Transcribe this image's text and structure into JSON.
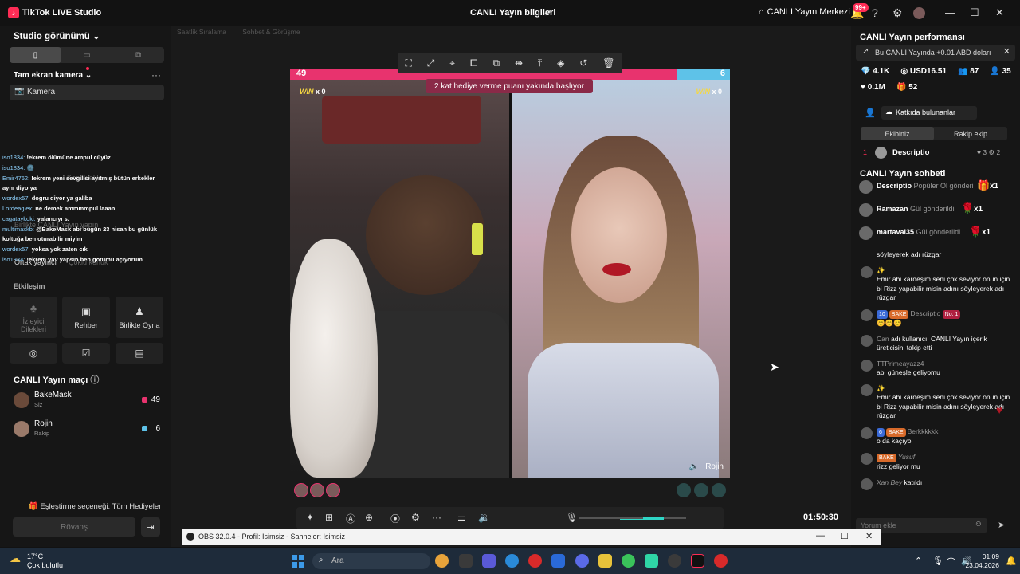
{
  "titlebar": {
    "app_name": "TikTok LIVE Studio",
    "center_title": "CANLI Yayın bilgileri",
    "live_center": "CANLI Yayın Merkezi",
    "notif_badge": "99+"
  },
  "left": {
    "studio_view": "Studio görünümü",
    "fullscreen_camera": "Tam ekran kamera",
    "camera": "Kamera",
    "chat_overlay": [
      {
        "user": "iso1834:",
        "text": "!ekrem ölümüne ampul cüyüz"
      },
      {
        "user": "iso1834:",
        "text": "🌚"
      },
      {
        "user": "Emir4762:",
        "text": "!ekrem yeni sevgilisi ayıtmış bütün erkekler aynı diyo ya"
      },
      {
        "user": "wordex57:",
        "text": "dogru diyor ya galiba"
      },
      {
        "user": "Lordeaglex:",
        "text": "ne demek ammmmpul laaan"
      },
      {
        "user": "cagataykoki:",
        "text": "yalancıyı s."
      },
      {
        "user": "multimaxkb:",
        "text": "@BakeMask abi bugün 23 nisan bu günlük koltuğa ben oturabilir miyim"
      },
      {
        "user": "wordex57:",
        "text": "yoksa yok zaten cık"
      },
      {
        "user": "iso1834:",
        "text": "!ekrem yav yapsın ben götümü açıyorum"
      }
    ],
    "ghost_labels": [
      "Konuk ekle",
      "Birlikte CANLI Yayın yapın",
      "Ortak yayıncı",
      "Çoklu konuk"
    ],
    "engagement_title": "Etkileşim",
    "tiles": [
      {
        "icon": "♣",
        "label": "İzleyici Dilekleri"
      },
      {
        "icon": "▣",
        "label": "Rehber"
      },
      {
        "icon": "♟",
        "label": "Birlikte Oyna"
      }
    ],
    "match_title": "CANLI Yayın maçı",
    "players": [
      {
        "name": "BakeMask",
        "sub": "Siz",
        "score": "49"
      },
      {
        "name": "Rojin",
        "sub": "Rakip",
        "score": "6"
      }
    ],
    "pairing": "Eşleştirme seçeneği: Tüm Hediyeler",
    "rematch": "Rövanş"
  },
  "center": {
    "chips": [
      "Saatlik Sıralama",
      "Sohbet & Görüşme"
    ],
    "score_left": "49",
    "score_right": "6",
    "win_left": "WIN",
    "win_left_count": "x 0",
    "win_right": "WIN",
    "win_right_count": "x 0",
    "banner": "2 kat hediye verme puanı yakında başlıyor",
    "opponent_name": "Rojin",
    "timer": "01:50:30",
    "volume_level": 0.66
  },
  "right": {
    "perf_title": "CANLI Yayın performansı",
    "perf_note": "Bu CANLI Yayında +0.01 ABD doları",
    "stats_row1": [
      "4.1K",
      "USD16.51",
      "87",
      "35"
    ],
    "stats_row2": [
      "0.1M",
      "52"
    ],
    "contributors": "Katkıda bulunanlar",
    "tab_team": "Ekibiniz",
    "tab_rival": "Rakip ekip",
    "rank_num": "1",
    "rank_name": "Descriptio",
    "rank_stats": "♥ 3  ⚙ 2",
    "chat_title": "CANLI Yayın sohbeti",
    "gifts": [
      {
        "name": "Descriptio",
        "action": "Popüler Ol gönderi",
        "count": "x1"
      },
      {
        "name": "Ramazan",
        "action": "Gül gönderildi",
        "count": "x1"
      },
      {
        "name": "martaval35",
        "action": "Gül gönderildi",
        "count": "x1"
      }
    ],
    "messages": [
      {
        "name": "",
        "text": "söyleyerek adı rüzgar"
      },
      {
        "name": "✨",
        "text": "Emir abi kardeşim seni çok seviyor onun için bi Rizz yapabilir misin adını söyleyerek adı rüzgar"
      },
      {
        "name": "Descriptio",
        "text": "😊😊😊",
        "tags": [
          "10",
          "BAKE",
          "No. 1"
        ]
      },
      {
        "name": "Can",
        "text": "adı kullanıcı, CANLI Yayın içerik üreticisini takip etti"
      },
      {
        "name": "TTPrimeayazz4",
        "text": "abi güneşle geliyomu"
      },
      {
        "name": "✨",
        "text": "Emir abi kardeşim seni çok seviyor onun için bi Rizz yapabilir misin adını söyleyerek adı rüzgar"
      },
      {
        "name": "Berkkkkkk",
        "text": "o da kaçıyo",
        "tags": [
          "6",
          "BAKE"
        ]
      },
      {
        "name": "Yusuf",
        "text": "rizz geliyor mu",
        "tags": [
          "BAKE"
        ]
      },
      {
        "name": "Xan Bey",
        "text": "katıldı"
      }
    ],
    "comment_placeholder": "Yorum ekle"
  },
  "obs": {
    "title": "OBS 32.0.4 - Profil: İsimsiz - Sahneler: İsimsiz"
  },
  "taskbar": {
    "temp": "17°C",
    "weather": "Çok bulutlu",
    "search": "Ara",
    "time": "01:09",
    "date": "23.04.2026"
  },
  "colors": {
    "accent": "#fe2c55",
    "team_pink": "#e8336e",
    "team_blue": "#5ec2e8",
    "volume": "#2fd6c6"
  }
}
